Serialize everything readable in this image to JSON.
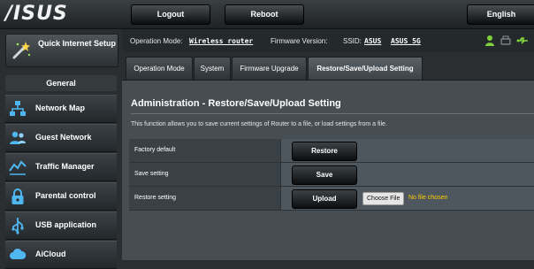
{
  "header": {
    "logo_text": "/ISUS",
    "logout_label": "Logout",
    "reboot_label": "Reboot",
    "language": "English"
  },
  "sidebar": {
    "quick_setup_label": "Quick Internet Setup",
    "section_title": "General",
    "items": [
      {
        "label": "Network Map",
        "icon": "network-map-icon"
      },
      {
        "label": "Guest Network",
        "icon": "guest-network-icon"
      },
      {
        "label": "Traffic Manager",
        "icon": "traffic-manager-icon"
      },
      {
        "label": "Parental control",
        "icon": "parental-control-icon"
      },
      {
        "label": "USB application",
        "icon": "usb-application-icon"
      },
      {
        "label": "AiCloud",
        "icon": "aicloud-icon"
      }
    ]
  },
  "status": {
    "mode_prefix": "Operation Mode:",
    "mode_value": "Wireless router",
    "firmware_label": "Firmware Version:",
    "ssid_label": "SSID:",
    "ssid_1": "ASUS",
    "ssid_2": "ASUS_5G"
  },
  "tabs": [
    {
      "label": "Operation Mode",
      "active": false
    },
    {
      "label": "System",
      "active": false
    },
    {
      "label": "Firmware Upgrade",
      "active": false
    },
    {
      "label": "Restore/Save/Upload Setting",
      "active": true
    }
  ],
  "main": {
    "title": "Administration - Restore/Save/Upload Setting",
    "description": "This function allows you to save current settings of Router to a file, or load settings from a file.",
    "rows": [
      {
        "label": "Factory default",
        "button": "Restore"
      },
      {
        "label": "Save setting",
        "button": "Save"
      },
      {
        "label": "Restore setting",
        "button": "Upload"
      }
    ],
    "choose_file_label": "Choose File",
    "file_status": "No file chosen"
  },
  "colors": {
    "accent_green": "#7fd13b",
    "file_status_yellow": "#ffcc00",
    "background_dark": "#2a2e30"
  }
}
